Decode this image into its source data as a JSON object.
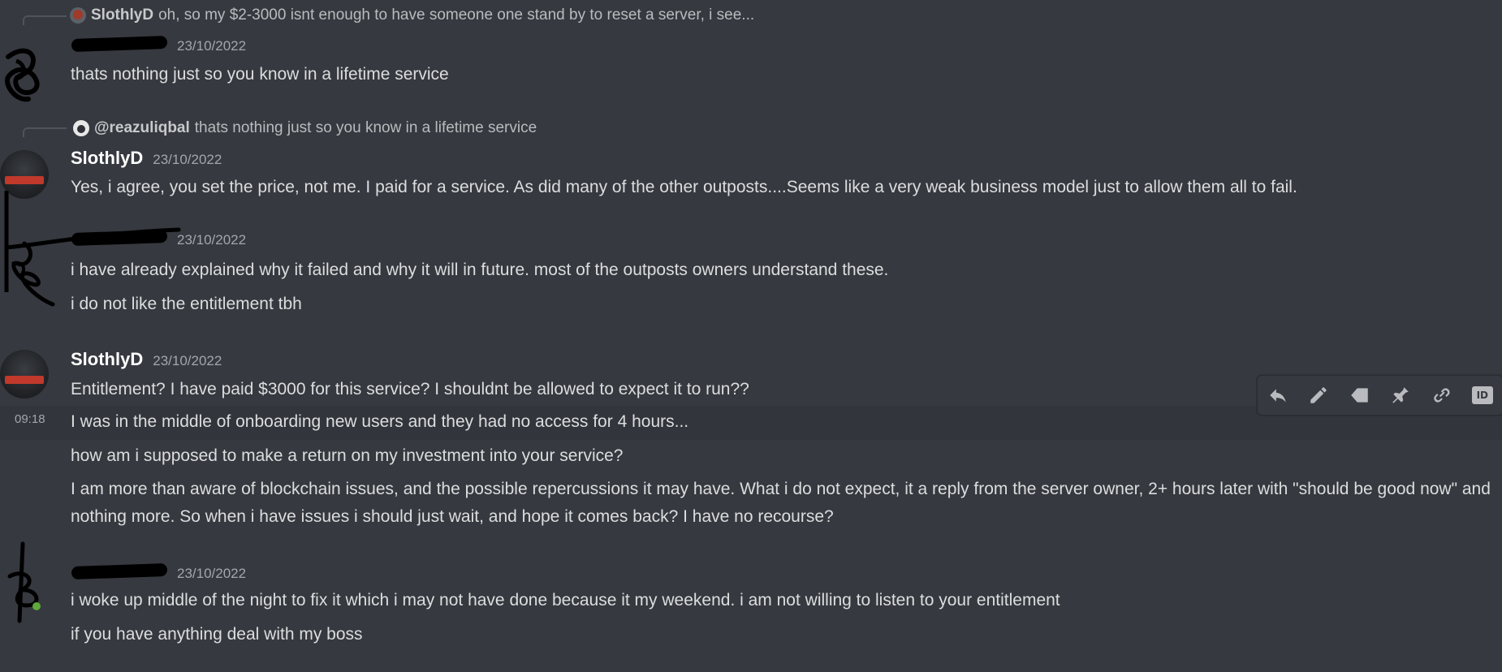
{
  "colors": {
    "background": "#36393f",
    "hover_row": "#32353b",
    "text": "#dcddde",
    "muted": "#a3a6aa",
    "username": "#ffffff"
  },
  "messages": [
    {
      "reply": {
        "author": "SlothlyD",
        "text": "oh, so my $2-3000 isnt enough to have someone one stand by to reset a server, i see..."
      },
      "timestamp": "23/10/2022",
      "lines": [
        "thats nothing just so you know in a lifetime service"
      ]
    },
    {
      "reply": {
        "author": "@reazuliqbal",
        "text": "thats nothing just so you know in a lifetime service"
      },
      "author": "SlothlyD",
      "timestamp": "23/10/2022",
      "lines": [
        "Yes, i agree, you set the price, not me. I paid for a service. As did many of the other outposts....Seems like a very weak business model just to allow them all to fail."
      ]
    },
    {
      "timestamp": "23/10/2022",
      "lines": [
        "i have already explained why it failed and why it will in future. most of the outposts owners understand these.",
        "i do not like the entitlement tbh"
      ]
    },
    {
      "author": "SlothlyD",
      "timestamp": "23/10/2022",
      "lines": [
        "Entitlement? I have paid $3000 for this service? I shouldnt be allowed to expect it to run??",
        "I was in the middle of onboarding new users and they had no access for 4 hours...",
        "how am i supposed to make a return on my investment into your service?",
        "I am more than aware of blockchain issues, and the possible repercussions it may have. What i do not expect, it a reply from the server owner, 2+ hours later with \"should be good now\" and nothing more. So when i have issues i should just wait, and hope it comes back? I have no recourse?"
      ],
      "hover_time": "09:18"
    },
    {
      "timestamp": "23/10/2022",
      "lines": [
        "i woke up middle of the night to fix it which i may not have done because it my weekend. i am not willing to listen to your entitlement",
        "if you have anything deal with my boss"
      ]
    }
  ],
  "toolbar": {
    "icons": [
      "reply-icon",
      "edit-icon",
      "tag-icon",
      "pin-icon",
      "link-icon",
      "id-icon"
    ],
    "id_label": "ID"
  }
}
